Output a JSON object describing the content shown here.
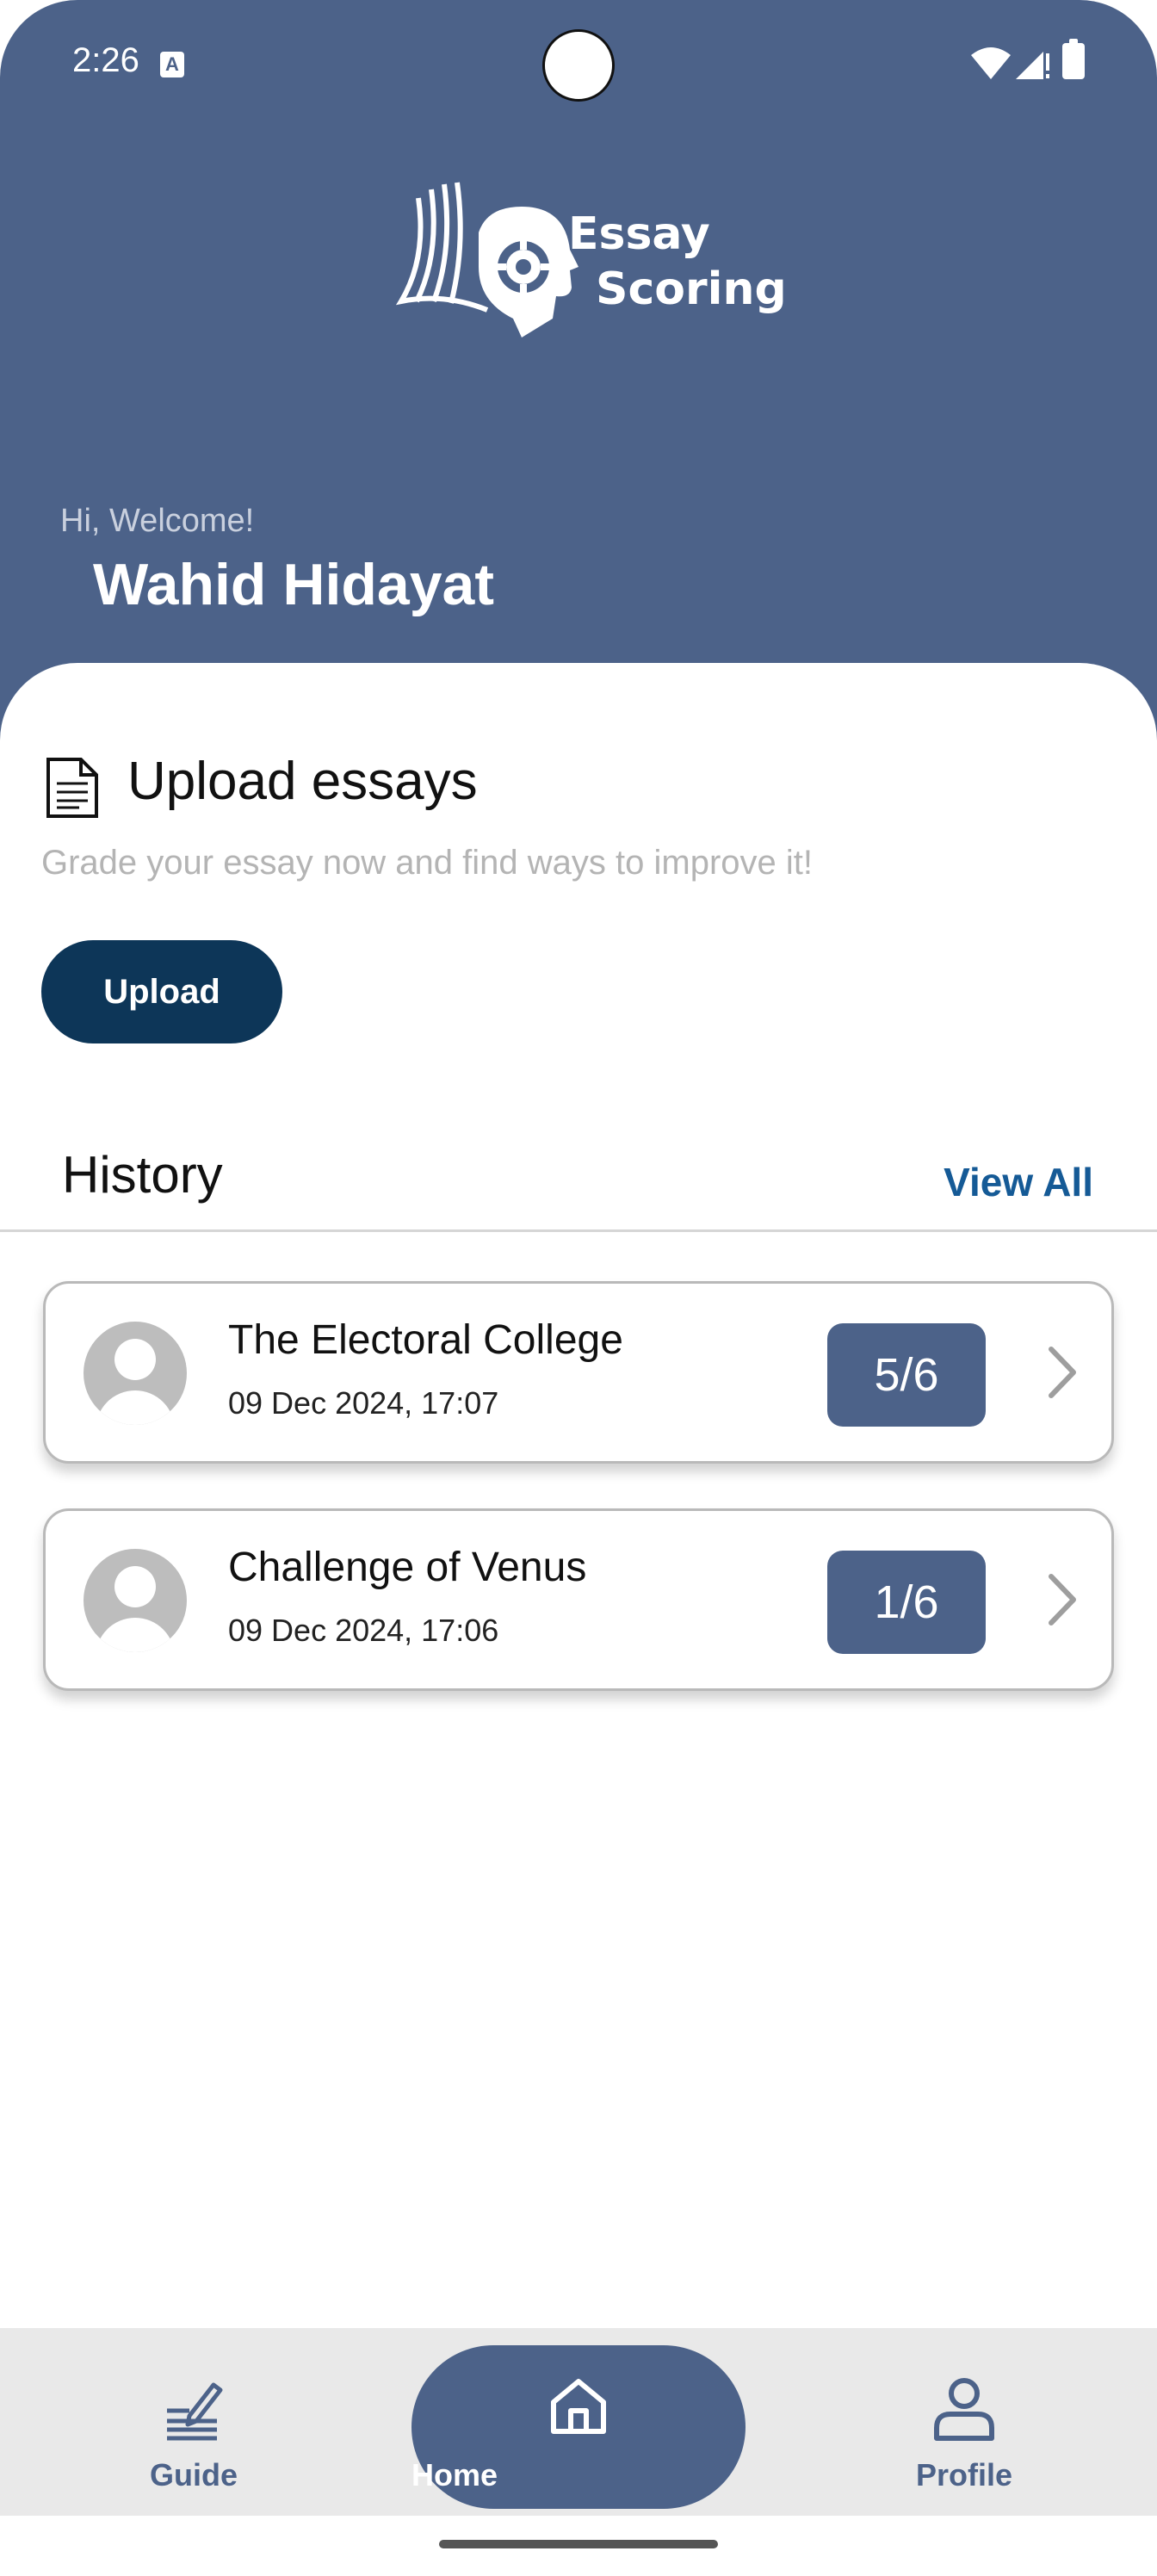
{
  "status_bar": {
    "time": "2:26",
    "a_icon_letter": "A"
  },
  "header": {
    "logo_line1": "Essay",
    "logo_line2": "Scoring",
    "welcome": "Hi, Welcome!",
    "user_name": "Wahid Hidayat"
  },
  "upload_section": {
    "title": "Upload essays",
    "subtitle": "Grade your essay now and find ways to improve it!",
    "button_label": "Upload"
  },
  "history": {
    "title": "History",
    "view_all": "View All",
    "items": [
      {
        "title": "The Electoral College",
        "date": "09 Dec 2024, 17:07",
        "score": "5/6"
      },
      {
        "title": "Challenge of Venus",
        "date": "09 Dec 2024, 17:06",
        "score": "1/6"
      }
    ]
  },
  "bottom_nav": {
    "guide": "Guide",
    "home": "Home",
    "profile": "Profile"
  },
  "colors": {
    "primary": "#4c6289",
    "button_dark": "#0d3658",
    "link": "#155a96"
  }
}
